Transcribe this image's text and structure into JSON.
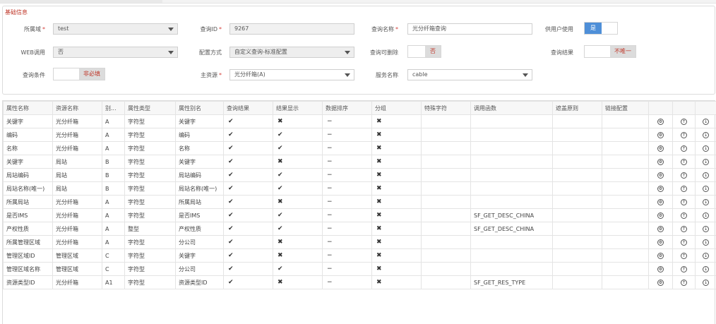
{
  "basic": {
    "title": "基础信息",
    "domain_label": "所属域",
    "domain_value": "test",
    "query_id_label": "查询ID",
    "query_id_value": "9267",
    "query_name_label": "查询名称",
    "query_name_value": "光分纤箱查询",
    "for_user_label": "供用户使用",
    "for_user_value": "是",
    "web_label": "WEB调用",
    "web_value": "否",
    "config_label": "配置方式",
    "config_value": "自定义查询-标准配置",
    "deletable_label": "查询可删除",
    "deletable_value": "否",
    "result_label": "查询结果",
    "result_value": "不唯一",
    "condition_label": "查询条件",
    "condition_value": "非必填",
    "resource_label": "主资源",
    "resource_value": "光分纤箱(A)",
    "service_label": "服务名称",
    "service_value": "cable"
  },
  "grid": {
    "headers": [
      "属性名称",
      "资源名称",
      "别...",
      "属性类型",
      "属性别名",
      "查询结果",
      "结果显示",
      "数据排序",
      "分组",
      "特殊字符",
      "调用函数",
      "遮盖原则",
      "链接配置"
    ],
    "rows": [
      [
        "关键字",
        "光分纤箱",
        "A",
        "字符型",
        "关键字",
        "✔",
        "✖",
        "−",
        "✖",
        "",
        "",
        "",
        ""
      ],
      [
        "编码",
        "光分纤箱",
        "A",
        "字符型",
        "编码",
        "✔",
        "✔",
        "−",
        "✖",
        "",
        "",
        "",
        ""
      ],
      [
        "名称",
        "光分纤箱",
        "A",
        "字符型",
        "名称",
        "✔",
        "✔",
        "−",
        "✖",
        "",
        "",
        "",
        ""
      ],
      [
        "关键字",
        "局站",
        "B",
        "字符型",
        "关键字",
        "✔",
        "✖",
        "−",
        "✖",
        "",
        "",
        "",
        ""
      ],
      [
        "局站编码",
        "局站",
        "B",
        "字符型",
        "局站编码",
        "✔",
        "✔",
        "−",
        "✖",
        "",
        "",
        "",
        ""
      ],
      [
        "局站名称(唯一)",
        "局站",
        "B",
        "字符型",
        "局站名称(唯一)",
        "✔",
        "✔",
        "−",
        "✖",
        "",
        "",
        "",
        ""
      ],
      [
        "所属局站",
        "光分纤箱",
        "A",
        "字符型",
        "所属局站",
        "✔",
        "✖",
        "−",
        "✖",
        "",
        "",
        "",
        ""
      ],
      [
        "是否IMS",
        "光分纤箱",
        "A",
        "字符型",
        "是否IMS",
        "✔",
        "✔",
        "−",
        "✖",
        "",
        "SF_GET_DESC_CHINA",
        "",
        ""
      ],
      [
        "产权性质",
        "光分纤箱",
        "A",
        "整型",
        "产权性质",
        "✔",
        "✔",
        "−",
        "✖",
        "",
        "SF_GET_DESC_CHINA",
        "",
        ""
      ],
      [
        "所属管理区域",
        "光分纤箱",
        "A",
        "字符型",
        "分公司",
        "✔",
        "✖",
        "−",
        "✖",
        "",
        "",
        "",
        ""
      ],
      [
        "管理区域ID",
        "管理区域",
        "C",
        "字符型",
        "关键字",
        "✔",
        "✖",
        "−",
        "✖",
        "",
        "",
        "",
        ""
      ],
      [
        "管理区域名称",
        "管理区域",
        "C",
        "字符型",
        "分公司",
        "✔",
        "✔",
        "−",
        "✖",
        "",
        "",
        "",
        ""
      ],
      [
        "资源类型ID",
        "光分纤箱",
        "A1",
        "字符型",
        "资源类型ID",
        "✔",
        "✖",
        "−",
        "✖",
        "",
        "SF_GET_RES_TYPE",
        "",
        ""
      ]
    ],
    "actions": [
      "settings-icon",
      "move-up-icon",
      "move-down-icon"
    ],
    "action_glyphs": [
      "⚙",
      "↑",
      "↓"
    ]
  }
}
